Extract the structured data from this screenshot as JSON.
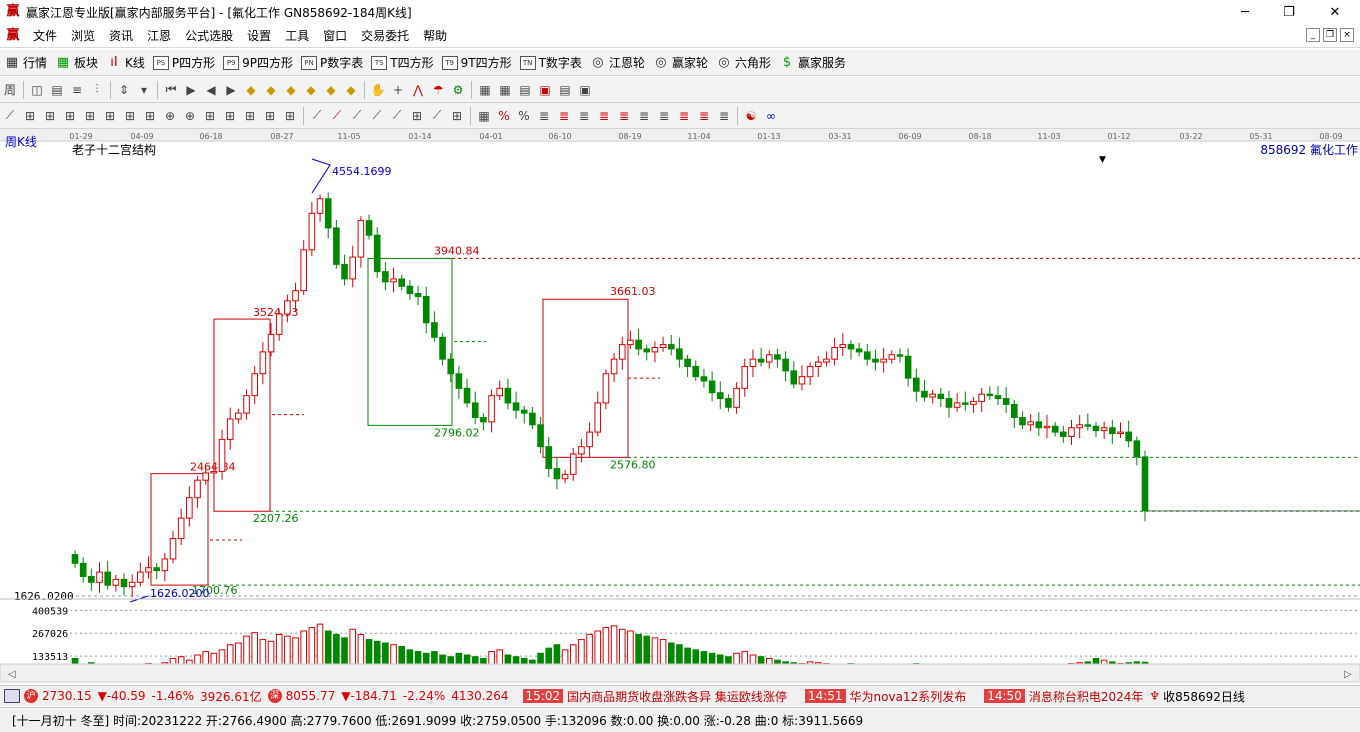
{
  "window": {
    "title": "赢家江恩专业版[赢家内部服务平台] - [氟化工作  GN858692-184周K线]",
    "logo": "赢",
    "min": "─",
    "max": "❐",
    "close": "✕"
  },
  "menu": {
    "logo": "赢",
    "items": [
      "文件",
      "浏览",
      "资讯",
      "江恩",
      "公式选股",
      "设置",
      "工具",
      "窗口",
      "交易委托",
      "帮助"
    ],
    "mdi": [
      "_",
      "❐",
      "×"
    ]
  },
  "toolbar1": [
    {
      "icon": "grid-icon",
      "label": "行情",
      "glyph": "▦"
    },
    {
      "icon": "blocks-icon",
      "label": "板块",
      "glyph": "▦"
    },
    {
      "icon": "kline-icon",
      "label": "K线",
      "glyph": "ıI"
    },
    {
      "icon": "ps-icon",
      "label": "P四方形",
      "glyph": "PS"
    },
    {
      "icon": "p9-icon",
      "label": "9P四方形",
      "glyph": "P9"
    },
    {
      "icon": "pn-icon",
      "label": "P数字表",
      "glyph": "PN"
    },
    {
      "icon": "ts-icon",
      "label": "T四方形",
      "glyph": "TS"
    },
    {
      "icon": "t9-icon",
      "label": "9T四方形",
      "glyph": "T9"
    },
    {
      "icon": "tn-icon",
      "label": "T数字表",
      "glyph": "TN"
    },
    {
      "icon": "gann-wheel-icon",
      "label": "江恩轮",
      "glyph": "◎"
    },
    {
      "icon": "winner-wheel-icon",
      "label": "赢家轮",
      "glyph": "◎"
    },
    {
      "icon": "hexagon-icon",
      "label": "六角形",
      "glyph": "◎"
    },
    {
      "icon": "dollar-icon",
      "label": "赢家服务",
      "glyph": "$"
    }
  ],
  "chart": {
    "period_label": "周K线",
    "indicator_name": "老子十二宫结构",
    "code_label": "858692 氟化工作",
    "date_ticks": [
      "01-29",
      "04-09",
      "06-18",
      "08-27",
      "11-05",
      "01-14",
      "04-01",
      "06-10",
      "08-19",
      "11-04",
      "01-13",
      "03-31",
      "06-09",
      "08-18",
      "11-03",
      "01-12",
      "03-22",
      "05-31",
      "08-09"
    ],
    "price_labels": {
      "high": "4554.1699",
      "low": "1626.0200",
      "left_axis_low": "1626.0200",
      "l3940": "3940.84",
      "l3661": "3661.03",
      "l3524": "3524.93",
      "l2796": "2796.02",
      "l2576": "2576.80",
      "l2464": "2464.84",
      "l2207": "2207.26",
      "l1700": "1700.76"
    },
    "volume_ticks": [
      "400539",
      "267026",
      "133513"
    ]
  },
  "chart_data": {
    "type": "candlestick",
    "title": "老子十二宫结构",
    "series_name": "858692 氟化工作",
    "period": "周K线",
    "x": [
      "01-29",
      "04-09",
      "06-18",
      "08-27",
      "11-05",
      "01-14",
      "04-01",
      "06-10",
      "08-19",
      "11-04",
      "01-13",
      "03-31",
      "06-09",
      "08-18",
      "11-03",
      "01-12",
      "03-22",
      "05-31",
      "08-09"
    ],
    "ylim": [
      1500,
      4700
    ],
    "horizontal_levels": [
      3940.84,
      3661.03,
      2576.8,
      2207.26,
      1700.76
    ],
    "annotations": [
      {
        "label": "4554.1699",
        "value": 4554.1699
      },
      {
        "label": "3940.84",
        "value": 3940.84
      },
      {
        "label": "3661.03",
        "value": 3661.03
      },
      {
        "label": "3524.93",
        "value": 3524.93
      },
      {
        "label": "2796.02",
        "value": 2796.02
      },
      {
        "label": "2576.80",
        "value": 2576.8
      },
      {
        "label": "2464.84",
        "value": 2464.84
      },
      {
        "label": "2207.26",
        "value": 2207.26
      },
      {
        "label": "1700.76",
        "value": 1700.76
      },
      {
        "label": "1626.0200",
        "value": 1626.02
      }
    ],
    "closes": [
      1850,
      1760,
      1720,
      1790,
      1700,
      1740,
      1690,
      1720,
      1790,
      1820,
      1800,
      1880,
      2020,
      2160,
      2300,
      2420,
      2470,
      2480,
      2700,
      2840,
      2880,
      3000,
      3150,
      3300,
      3420,
      3560,
      3650,
      3720,
      4000,
      4250,
      4350,
      4150,
      3900,
      3800,
      3950,
      4200,
      4100,
      3850,
      3780,
      3800,
      3750,
      3700,
      3680,
      3500,
      3400,
      3250,
      3150,
      3050,
      2950,
      2850,
      2820,
      3000,
      3050,
      2950,
      2900,
      2880,
      2800,
      2650,
      2500,
      2430,
      2460,
      2600,
      2650,
      2750,
      2950,
      3150,
      3250,
      3350,
      3380,
      3320,
      3300,
      3330,
      3350,
      3320,
      3250,
      3200,
      3130,
      3100,
      3020,
      2980,
      2920,
      3050,
      3200,
      3250,
      3230,
      3280,
      3250,
      3170,
      3080,
      3130,
      3200,
      3230,
      3250,
      3330,
      3350,
      3320,
      3300,
      3250,
      3230,
      3250,
      3280,
      3270,
      3120,
      3030,
      2990,
      3010,
      2980,
      2920,
      2950,
      2940,
      2960,
      3010,
      3000,
      2980,
      2940,
      2850,
      2800,
      2820,
      2780,
      2790,
      2750,
      2720,
      2780,
      2800,
      2790,
      2760,
      2780,
      2740,
      2750,
      2690,
      2580,
      2210
    ],
    "volumes": [
      120000,
      80000,
      95000,
      70000,
      85000,
      60000,
      75000,
      70000,
      65000,
      90000,
      85000,
      95000,
      120000,
      130000,
      110000,
      140000,
      160000,
      150000,
      170000,
      200000,
      210000,
      250000,
      270000,
      230000,
      220000,
      260000,
      250000,
      240000,
      280000,
      300000,
      320000,
      280000,
      260000,
      240000,
      290000,
      260000,
      230000,
      220000,
      210000,
      200000,
      190000,
      170000,
      160000,
      150000,
      160000,
      140000,
      130000,
      150000,
      140000,
      130000,
      120000,
      160000,
      170000,
      140000,
      130000,
      120000,
      110000,
      150000,
      180000,
      200000,
      170000,
      200000,
      230000,
      260000,
      280000,
      300000,
      310000,
      290000,
      280000,
      260000,
      250000,
      240000,
      230000,
      210000,
      200000,
      180000,
      170000,
      160000,
      150000,
      140000,
      130000,
      150000,
      160000,
      140000,
      130000,
      120000,
      110000,
      100000,
      95000,
      90000,
      100000,
      95000,
      90000,
      85000,
      80000,
      90000,
      85000,
      80000,
      75000,
      70000,
      75000,
      80000,
      85000,
      90000,
      75000,
      70000,
      65000,
      60000,
      70000,
      65000,
      60000,
      65000,
      70000,
      75000,
      80000,
      70000,
      65000,
      60000,
      70000,
      75000,
      80000,
      85000,
      90000,
      95000,
      100000,
      120000,
      110000,
      100000,
      90000,
      95000,
      100000,
      98000
    ],
    "volume_ticks": [
      400539,
      267026,
      133513
    ]
  },
  "status1": {
    "sh_value": "2730.15",
    "sh_change": "▼-40.59",
    "sh_pct": "-1.46%",
    "sh_amount": "3926.61亿",
    "sz_value": "8055.77",
    "sz_change": "▼-184.71",
    "sz_pct": "-2.24%",
    "sz_amount": "4130.26",
    "sz_suffix": "4",
    "news": [
      {
        "time": "15:02",
        "text": "国内商品期货收盘涨跌各异 集运欧线涨停"
      },
      {
        "time": "14:51",
        "text": "华为nova12系列发布"
      },
      {
        "time": "14:50",
        "text": "消息称台积电2024年"
      }
    ],
    "right_text": "收858692日线"
  },
  "status2": {
    "text": "[十一月初十 冬至] 时间:20231222 开:2766.4900 高:2779.7600 低:2691.9099 收:2759.0500 手:132096 数:0.00 换:0.00 涨:-0.28 曲:0 标:3911.5669"
  }
}
